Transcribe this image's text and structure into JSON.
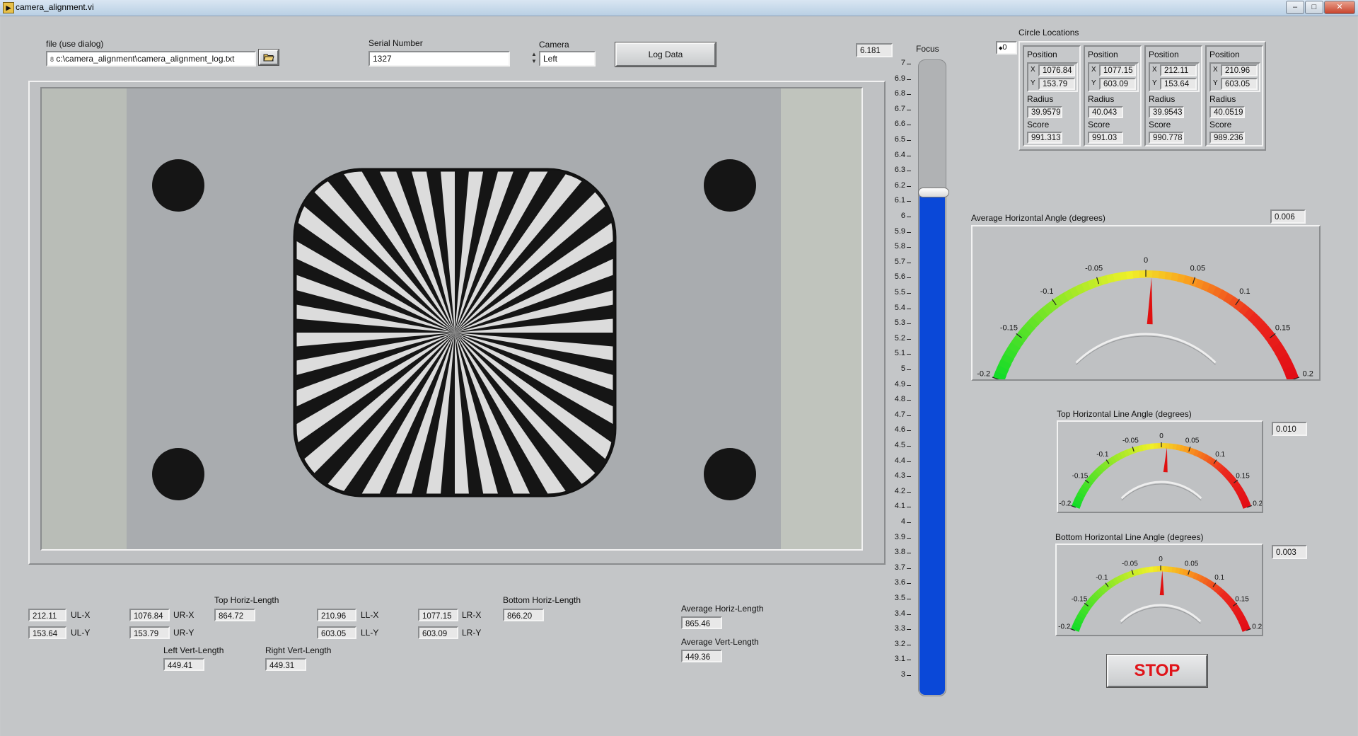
{
  "window": {
    "title": "camera_alignment.vi",
    "icon": "labview-vi-icon",
    "min": "–",
    "max": "□",
    "close": "✕"
  },
  "file": {
    "label": "file (use dialog)",
    "value": "c:\\camera_alignment\\camera_alignment_log.txt",
    "browse_icon": "folder-open-icon",
    "path_glyph": "8"
  },
  "serial": {
    "label": "Serial Number",
    "value": "1327"
  },
  "camera": {
    "label": "Camera",
    "value": "Left"
  },
  "log_button": {
    "label": "Log Data"
  },
  "focus": {
    "label": "Focus",
    "value_display": "6.181",
    "value": 6.181,
    "min": 3,
    "max": 7,
    "ticks": [
      "7",
      "6.9",
      "6.8",
      "6.7",
      "6.6",
      "6.5",
      "6.4",
      "6.3",
      "6.2",
      "6.1",
      "6",
      "5.9",
      "5.8",
      "5.7",
      "5.6",
      "5.5",
      "5.4",
      "5.3",
      "5.2",
      "5.1",
      "5",
      "4.9",
      "4.8",
      "4.7",
      "4.6",
      "4.5",
      "4.4",
      "4.3",
      "4.2",
      "4.1",
      "4",
      "3.9",
      "3.8",
      "3.7",
      "3.6",
      "3.5",
      "3.4",
      "3.3",
      "3.2",
      "3.1",
      "3"
    ],
    "fill_color": "#0a48d8"
  },
  "circles": {
    "label": "Circle Locations",
    "index": "0",
    "items": [
      {
        "position_label": "Position",
        "x_label": "X",
        "x": "1076.84",
        "y_label": "Y",
        "y": "153.79",
        "radius_label": "Radius",
        "radius": "39.9579",
        "score_label": "Score",
        "score": "991.313"
      },
      {
        "position_label": "Position",
        "x_label": "X",
        "x": "1077.15",
        "y_label": "Y",
        "y": "603.09",
        "radius_label": "Radius",
        "radius": "40.043",
        "score_label": "Score",
        "score": "991.03"
      },
      {
        "position_label": "Position",
        "x_label": "X",
        "x": "212.11",
        "y_label": "Y",
        "y": "153.64",
        "radius_label": "Radius",
        "radius": "39.9543",
        "score_label": "Score",
        "score": "990.778"
      },
      {
        "position_label": "Position",
        "x_label": "X",
        "x": "210.96",
        "y_label": "Y",
        "y": "603.05",
        "radius_label": "Radius",
        "radius": "40.0519",
        "score_label": "Score",
        "score": "989.236"
      }
    ]
  },
  "gauges": {
    "avg": {
      "label": "Average Horizontal Angle (degrees)",
      "value_display": "0.006",
      "value": 0.006
    },
    "top": {
      "label": "Top Horizontal Line Angle (degrees)",
      "value_display": "0.010",
      "value": 0.01
    },
    "bottom": {
      "label": "Bottom Horizontal Line Angle (degrees)",
      "value_display": "0.003",
      "value": 0.003
    },
    "scale_labels": [
      "-0.2",
      "-0.15",
      "-0.1",
      "-0.05",
      "0",
      "0.05",
      "0.1",
      "0.15",
      "0.2"
    ],
    "needle_color": "#e01010"
  },
  "measurements": {
    "ul_x": {
      "label": "UL-X",
      "value": "212.11"
    },
    "ul_y": {
      "label": "UL-Y",
      "value": "153.64"
    },
    "ur_x": {
      "label": "UR-X",
      "value": "1076.84"
    },
    "ur_y": {
      "label": "UR-Y",
      "value": "153.79"
    },
    "top_horiz": {
      "label": "Top Horiz-Length",
      "value": "864.72"
    },
    "ll_x": {
      "label": "LL-X",
      "value": "210.96"
    },
    "ll_y": {
      "label": "LL-Y",
      "value": "603.05"
    },
    "lr_x": {
      "label": "LR-X",
      "value": "1077.15"
    },
    "lr_y": {
      "label": "LR-Y",
      "value": "603.09"
    },
    "bottom_horiz": {
      "label": "Bottom Horiz-Length",
      "value": "866.20"
    },
    "left_vert": {
      "label": "Left Vert-Length",
      "value": "449.41"
    },
    "right_vert": {
      "label": "Right Vert-Length",
      "value": "449.31"
    },
    "avg_horiz": {
      "label": "Average Horiz-Length",
      "value": "865.46"
    },
    "avg_vert": {
      "label": "Average Vert-Length",
      "value": "449.36"
    }
  },
  "stop_button": {
    "label": "STOP",
    "color": "#e0141a"
  }
}
